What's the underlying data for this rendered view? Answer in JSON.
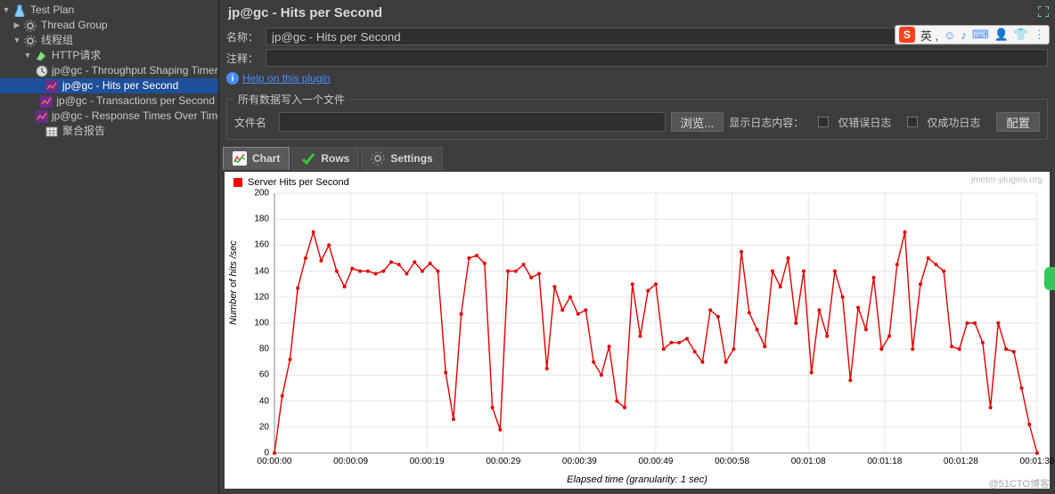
{
  "tree": {
    "items": [
      {
        "label": "Test Plan",
        "depth": 0,
        "exp": true,
        "icon": "flask"
      },
      {
        "label": "Thread Group",
        "depth": 1,
        "exp": false,
        "icon": "gear"
      },
      {
        "label": "线程组",
        "depth": 1,
        "exp": true,
        "icon": "gear"
      },
      {
        "label": "HTTP请求",
        "depth": 2,
        "exp": true,
        "icon": "http"
      },
      {
        "label": "jp@gc - Throughput Shaping Timer",
        "depth": 3,
        "icon": "clock"
      },
      {
        "label": "jp@gc - Hits per Second",
        "depth": 3,
        "icon": "chart",
        "selected": true
      },
      {
        "label": "jp@gc - Transactions per Second",
        "depth": 3,
        "icon": "chart"
      },
      {
        "label": "jp@gc - Response Times Over Time",
        "depth": 3,
        "icon": "chart"
      },
      {
        "label": "聚合报告",
        "depth": 3,
        "icon": "table"
      }
    ]
  },
  "panel": {
    "title": "jp@gc - Hits per Second",
    "name_label": "名称：",
    "name_value": "jp@gc - Hits per Second",
    "comment_label": "注释：",
    "comment_value": "",
    "help": "Help on this plugin",
    "group_legend": "所有数据写入一个文件",
    "filename_label": "文件名",
    "filename_value": "",
    "browse_btn": "浏览...",
    "log_label": "显示日志内容：",
    "only_error": "仅错误日志",
    "only_success": "仅成功日志",
    "config_btn": "配置"
  },
  "tabs": [
    {
      "label": "Chart",
      "icon": "chart",
      "active": true
    },
    {
      "label": "Rows",
      "icon": "check"
    },
    {
      "label": "Settings",
      "icon": "gear"
    }
  ],
  "ime": {
    "logo": "S",
    "lang": "英",
    "icons": [
      "☺",
      "♪",
      "⌨",
      "👤",
      "👕",
      "⋮"
    ]
  },
  "footer_wm": "@51CTO博客",
  "chart_data": {
    "type": "line",
    "title": "",
    "legend": "Server Hits per Second",
    "wm": "jmeter-plugins.org",
    "ylabel": "Number of hits /sec",
    "xlabel": "Elapsed time (granularity: 1 sec)",
    "ylim": [
      0,
      200
    ],
    "yticks": [
      0,
      20,
      40,
      60,
      80,
      100,
      120,
      140,
      160,
      180,
      200
    ],
    "xticks": [
      "00:00:00",
      "00:00:09",
      "00:00:19",
      "00:00:29",
      "00:00:39",
      "00:00:49",
      "00:00:58",
      "00:01:08",
      "00:01:18",
      "00:01:28",
      "00:01:38"
    ],
    "x": [
      0,
      1,
      2,
      3,
      4,
      5,
      6,
      7,
      8,
      9,
      10,
      11,
      12,
      13,
      14,
      15,
      16,
      17,
      18,
      19,
      20,
      21,
      22,
      23,
      24,
      25,
      26,
      27,
      28,
      29,
      30,
      31,
      32,
      33,
      34,
      35,
      36,
      37,
      38,
      39,
      40,
      41,
      42,
      43,
      44,
      45,
      46,
      47,
      48,
      49,
      50,
      51,
      52,
      53,
      54,
      55,
      56,
      57,
      58,
      59,
      60,
      61,
      62,
      63,
      64,
      65,
      66,
      67,
      68,
      69,
      70,
      71,
      72,
      73,
      74,
      75,
      76,
      77,
      78,
      79,
      80,
      81,
      82,
      83,
      84,
      85,
      86,
      87,
      88,
      89,
      90,
      91,
      92,
      93,
      94,
      95,
      96,
      97,
      98
    ],
    "values": [
      0,
      44,
      72,
      127,
      150,
      170,
      148,
      160,
      140,
      128,
      142,
      140,
      140,
      138,
      140,
      147,
      145,
      138,
      147,
      140,
      146,
      140,
      62,
      26,
      107,
      150,
      152,
      146,
      35,
      18,
      140,
      140,
      145,
      135,
      138,
      65,
      128,
      110,
      120,
      107,
      110,
      70,
      60,
      82,
      40,
      35,
      130,
      90,
      125,
      130,
      80,
      85,
      85,
      88,
      78,
      70,
      110,
      105,
      70,
      80,
      155,
      108,
      95,
      82,
      140,
      128,
      150,
      100,
      140,
      62,
      110,
      90,
      140,
      120,
      56,
      112,
      95,
      135,
      80,
      90,
      145,
      170,
      80,
      130,
      150,
      145,
      140,
      82,
      80,
      100,
      100,
      85,
      35,
      100,
      80,
      78,
      50,
      22,
      0
    ],
    "color": "#e00000"
  }
}
